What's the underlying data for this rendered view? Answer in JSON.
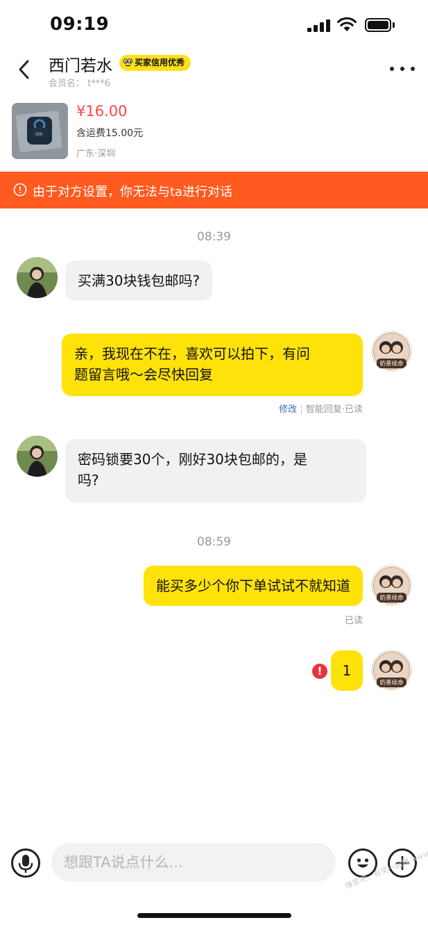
{
  "status_bar": {
    "time": "09:19"
  },
  "header": {
    "contact_name": "西门若水",
    "credit_badge": "买家信用优秀",
    "member_label": "会员名：",
    "member_id": "t***6"
  },
  "product": {
    "price": "¥16.00",
    "shipping": "含运费15.00元",
    "location": "广东·深圳"
  },
  "warning": {
    "text": "由于对方设置，你无法与ta进行对话",
    "color": "#ff5a1f"
  },
  "chat": {
    "timestamps": [
      "08:39",
      "08:59"
    ],
    "messages": [
      {
        "from": "other",
        "text": "买满30块钱包邮吗?"
      },
      {
        "from": "me",
        "text_line1": "亲，我现在不在，喜欢可以拍下，有问",
        "text_line2": "题留言哦～会尽快回复"
      },
      {
        "from": "other",
        "text_line1": "密码锁要30个，刚好30块包邮的，是",
        "text_line2": "吗?"
      },
      {
        "from": "me",
        "text": "能买多少个你下单试试不就知道"
      },
      {
        "from": "me",
        "text": "1",
        "error": "!"
      }
    ],
    "meta_1": {
      "edit": "修改",
      "separator": "|",
      "status": "智能回复·已读"
    },
    "meta_2": "已读",
    "my_avatar_label": "奶茶续命",
    "bubble_me_color": "#ffe20a",
    "bubble_other_color": "#f1f1f3"
  },
  "input": {
    "placeholder": "想跟TA说点什么..."
  },
  "watermark": "赚客吧，有奖一起赚 www.zuanke8.com"
}
